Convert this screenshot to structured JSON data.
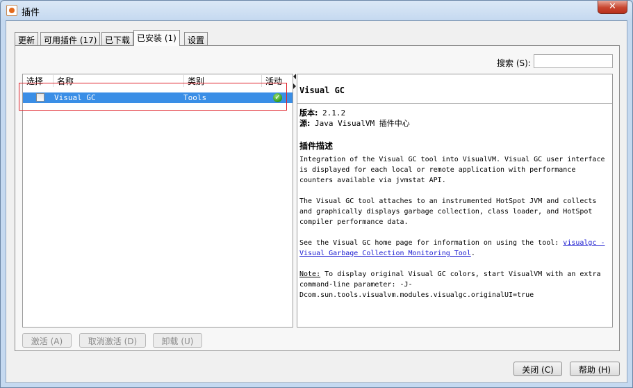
{
  "window": {
    "title": "插件",
    "close_label": "✕"
  },
  "tabs": [
    {
      "label": "更新"
    },
    {
      "label": "可用插件 (17)"
    },
    {
      "label": "已下载"
    },
    {
      "label": "已安装 (1)",
      "active": true
    },
    {
      "label": "设置"
    }
  ],
  "search": {
    "label": "搜索 (S):",
    "value": ""
  },
  "table": {
    "columns": [
      "选择",
      "名称",
      "类别",
      "活动"
    ],
    "rows": [
      {
        "selected": false,
        "name": "Visual GC",
        "category": "Tools",
        "active": true
      }
    ]
  },
  "detail": {
    "title": "Visual GC",
    "version_label": "版本:",
    "version": "2.1.2",
    "source_label": "源:",
    "source": "Java VisualVM 插件中心",
    "description_title": "插件描述",
    "para1": "Integration of the Visual GC tool into VisualVM. Visual GC user interface is displayed for each local or remote application with performance counters available via jvmstat API.",
    "para2": "The Visual GC tool attaches to an instrumented HotSpot JVM and collects and graphically displays garbage collection, class loader, and HotSpot compiler performance data.",
    "para3_prefix": "See the Visual GC home page for information on using the tool: ",
    "para3_link": "visualgc - Visual Garbage Collection Monitoring Tool",
    "para3_suffix": ".",
    "note_label": "Note:",
    "note_text": " To display original Visual GC colors, start VisualVM with an extra command-line parameter: -J-Dcom.sun.tools.visualvm.modules.visualgc.originalUI=true"
  },
  "actions": {
    "activate": "激活 (A)",
    "deactivate": "取消激活 (D)",
    "uninstall": "卸载 (U)"
  },
  "footer": {
    "close": "关闭 (C)",
    "help": "帮助 (H)"
  },
  "colors": {
    "selection": "#3a8ee6",
    "highlight_border": "#e0222a"
  }
}
